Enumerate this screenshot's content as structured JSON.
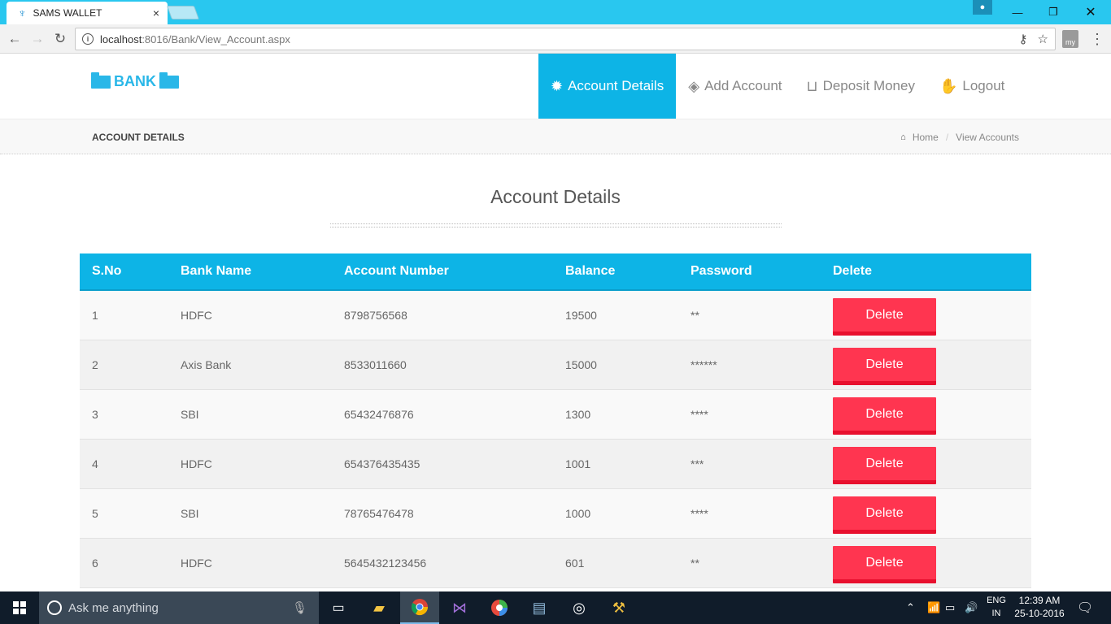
{
  "browser": {
    "tab_title": "SAMS WALLET",
    "tab_close": "×",
    "url_host": "localhost",
    "url_rest": ":8016/Bank/View_Account.aspx"
  },
  "site": {
    "brand": "BANK",
    "nav": [
      {
        "label": "Account Details",
        "icon": "cog-icon",
        "active": true
      },
      {
        "label": "Add Account",
        "icon": "tag-icon",
        "active": false
      },
      {
        "label": "Deposit Money",
        "icon": "inbox-icon",
        "active": false
      },
      {
        "label": "Logout",
        "icon": "hand-icon",
        "active": false
      }
    ],
    "accent_color": "#0db4e6",
    "delete_color": "#ff3550"
  },
  "breadcrumb": {
    "title": "ACCOUNT DETAILS",
    "home": "Home",
    "current": "View Accounts"
  },
  "main": {
    "heading": "Account Details",
    "columns": [
      "S.No",
      "Bank Name",
      "Account Number",
      "Balance",
      "Password",
      "Delete"
    ],
    "rows": [
      {
        "sno": "1",
        "bank": "HDFC",
        "account": "8798756568",
        "balance": "19500",
        "password": "**",
        "action": "Delete"
      },
      {
        "sno": "2",
        "bank": "Axis Bank",
        "account": "8533011660",
        "balance": "15000",
        "password": "******",
        "action": "Delete"
      },
      {
        "sno": "3",
        "bank": "SBI",
        "account": "65432476876",
        "balance": "1300",
        "password": "****",
        "action": "Delete"
      },
      {
        "sno": "4",
        "bank": "HDFC",
        "account": "654376435435",
        "balance": "1001",
        "password": "***",
        "action": "Delete"
      },
      {
        "sno": "5",
        "bank": "SBI",
        "account": "78765476478",
        "balance": "1000",
        "password": "****",
        "action": "Delete"
      },
      {
        "sno": "6",
        "bank": "HDFC",
        "account": "5645432123456",
        "balance": "601",
        "password": "**",
        "action": "Delete"
      }
    ]
  },
  "taskbar": {
    "search_placeholder": "Ask me anything",
    "lang_top": "ENG",
    "lang_bottom": "IN",
    "time": "12:39 AM",
    "date": "25-10-2016"
  }
}
